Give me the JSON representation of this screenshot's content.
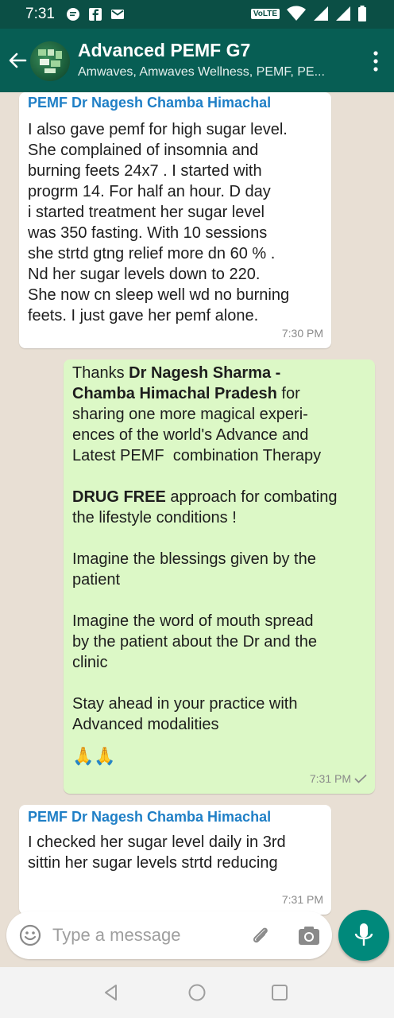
{
  "status_bar": {
    "time": "7:31",
    "network_label": "VoLTE",
    "icons": [
      "message-icon",
      "facebook-icon",
      "mail-icon",
      "wifi-icon",
      "signal-icon",
      "battery-icon"
    ]
  },
  "header": {
    "title": "Advanced PEMF G7",
    "subtitle": "Amwaves, Amwaves Wellness, PEMF, PE..."
  },
  "messages": [
    {
      "type": "incoming",
      "sender": "PEMF Dr Nagesh Chamba Himachal",
      "lines": [
        "I also gave pemf for high sugar level.",
        "She complained of insomnia and",
        "burning feets 24x7 . I started with",
        "progrm 14. For half an hour. D day",
        "i started treatment her sugar level",
        "was 350 fasting. With 10 sessions",
        "she strtd gtng relief more dn 60 % .",
        "Nd her sugar levels down to 220.",
        "She now cn sleep well wd no burning",
        "feets. I just gave her pemf alone."
      ],
      "time": "7:30 PM"
    },
    {
      "type": "outgoing",
      "p1_prefix": "Thanks ",
      "p1_bold": "Dr Nagesh Sharma -",
      "p1_bold2": "Chamba Himachal Pradesh",
      "p1_rest1": " for",
      "p1_line3": "sharing one more magical experi-",
      "p1_line4": "ences of the world's Advance and",
      "p1_line5": "Latest PEMF  combination Therapy",
      "p2_bold": "DRUG FREE",
      "p2_rest": " approach for combating",
      "p2_line2": "the lifestyle conditions !",
      "p3_line1": "Imagine the blessings given by the",
      "p3_line2": "patient",
      "p4_line1": "Imagine the word of mouth spread",
      "p4_line2": "by the patient about the Dr and the",
      "p4_line3": "clinic",
      "p5_line1": "Stay ahead in your practice with",
      "p5_line2": "Advanced modalities",
      "emoji": "🙏🙏",
      "time": "7:31 PM"
    },
    {
      "type": "incoming",
      "sender": "PEMF Dr Nagesh Chamba Himachal",
      "lines": [
        "I checked her sugar level daily in 3rd",
        "sittin her sugar levels strtd reducing"
      ],
      "time": "7:31 PM"
    }
  ],
  "input": {
    "placeholder": "Type a message"
  },
  "colors": {
    "header": "#075e54",
    "status_bar": "#0b4f45",
    "outgoing_bubble": "#dcf8c6",
    "sender_name": "#1f7fc6",
    "mic_button": "#00897b"
  }
}
